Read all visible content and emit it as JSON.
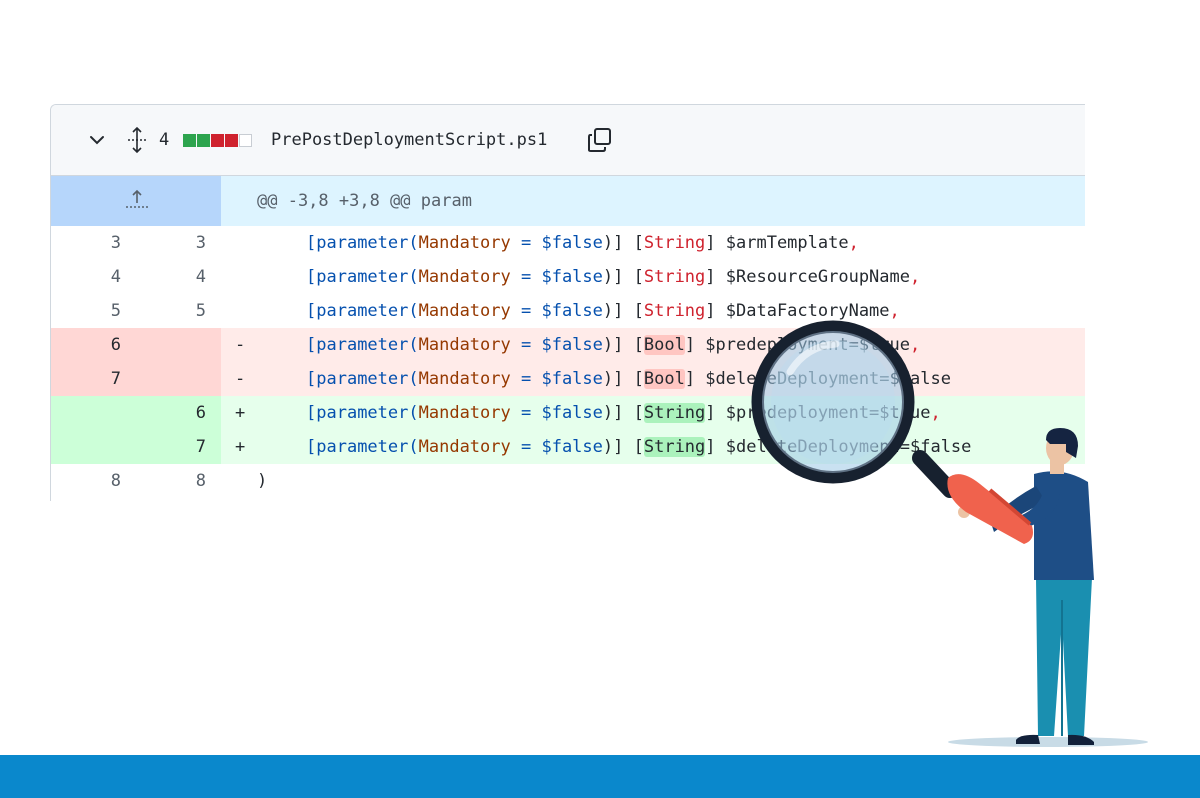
{
  "file": {
    "changes_count": "4",
    "name": "PrePostDeploymentScript.ps1",
    "diffstat": [
      "#2da44e",
      "#2da44e",
      "#cf222e",
      "#cf222e",
      "#ffffff"
    ]
  },
  "hunk": {
    "header": "@@ -3,8 +3,8 @@ param"
  },
  "tokens": {
    "lb": "[",
    "param_kw": "parameter",
    "lp": "(",
    "mandatory": "Mandatory",
    "eq": " = ",
    "false": "$false",
    "rp_rb": ")] ",
    "rb": "]",
    "string_t": "String",
    "bool_t": "Bool",
    "comma": ","
  },
  "lines": [
    {
      "old": "3",
      "new": "3",
      "sign": "",
      "type_name": "String",
      "var": " $armTemplate",
      "tail": ","
    },
    {
      "old": "4",
      "new": "4",
      "sign": "",
      "type_name": "String",
      "var": " $ResourceGroupName",
      "tail": ","
    },
    {
      "old": "5",
      "new": "5",
      "sign": "",
      "type_name": "String",
      "var": " $DataFactoryName",
      "tail": ","
    },
    {
      "old": "6",
      "new": "",
      "sign": "-",
      "type_name": "Bool",
      "var": " $predeployment=$true",
      "tail": ","
    },
    {
      "old": "7",
      "new": "",
      "sign": "-",
      "type_name": "Bool",
      "var": " $deleteDeployment=$false",
      "tail": ""
    },
    {
      "old": "",
      "new": "6",
      "sign": "+",
      "type_name": "String",
      "var": " $predeployment=$true",
      "tail": ","
    },
    {
      "old": "",
      "new": "7",
      "sign": "+",
      "type_name": "String",
      "var": " $deleteDeployment=$false",
      "tail": ""
    },
    {
      "old": "8",
      "new": "8",
      "sign": "",
      "closing": ")"
    }
  ],
  "icons": {
    "collapse": "chevron-down-icon",
    "expand": "expand-arrows-icon",
    "copy": "copy-icon",
    "expand_up": "expand-up-icon"
  },
  "colors": {
    "brand_bar": "#0a88cc",
    "deleted_bg": "#ffebe9",
    "added_bg": "#e6ffec",
    "hunk_bg": "#ddf4ff"
  }
}
